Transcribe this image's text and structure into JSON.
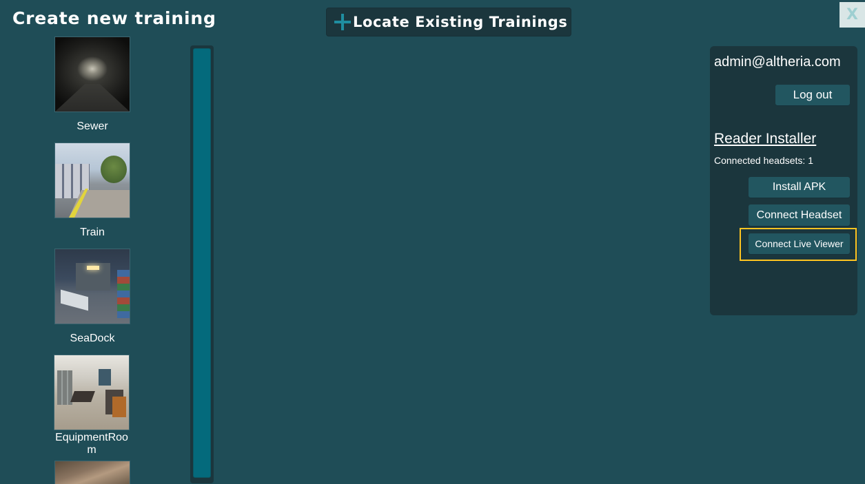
{
  "header": {
    "title": "Create new training",
    "locate_label": "Locate Existing Trainings",
    "close_label": "X"
  },
  "scenes": [
    {
      "name": "Sewer"
    },
    {
      "name": "Train"
    },
    {
      "name": "SeaDock"
    },
    {
      "name": "EquipmentRoom"
    }
  ],
  "account": {
    "email": "admin@altheria.com",
    "logout_label": "Log out"
  },
  "installer": {
    "title": "Reader Installer",
    "headsets_text": "Connected headsets: 1",
    "install_apk_label": "Install APK",
    "connect_headset_label": "Connect Headset",
    "connect_live_viewer_label": "Connect Live Viewer"
  },
  "colors": {
    "background": "#1f4d57",
    "panel": "#1b363d",
    "button": "#225660",
    "accent": "#046a7c",
    "highlight": "#ffc521"
  }
}
